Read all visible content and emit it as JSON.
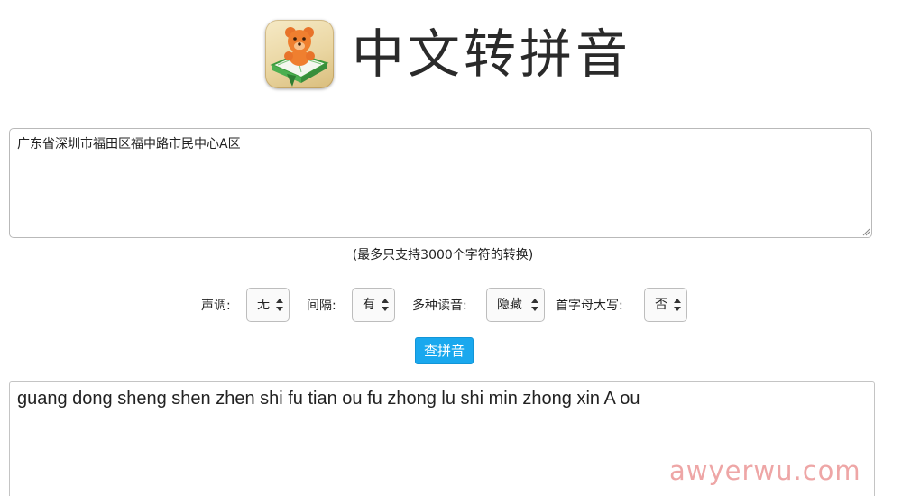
{
  "header": {
    "title": "中文转拼音",
    "logo_icon": "teddy-bear-on-book-icon"
  },
  "input": {
    "value": "广东省深圳市福田区福中路市民中心A区"
  },
  "note": "(最多只支持3000个字符的转换)",
  "options": {
    "tone_label": "声调:",
    "tone_value": "无",
    "spacing_label": "间隔:",
    "spacing_value": "有",
    "multi_reading_label": "多种读音:",
    "multi_reading_value": "隐藏",
    "capital_label": "首字母大写:",
    "capital_value": "否"
  },
  "button": {
    "query_label": "查拼音",
    "color": "#1aa8ee"
  },
  "output": {
    "value": "guang dong sheng shen zhen shi fu tian ou fu zhong lu shi min zhong xin A ou"
  },
  "watermark": "awyerwu.com"
}
